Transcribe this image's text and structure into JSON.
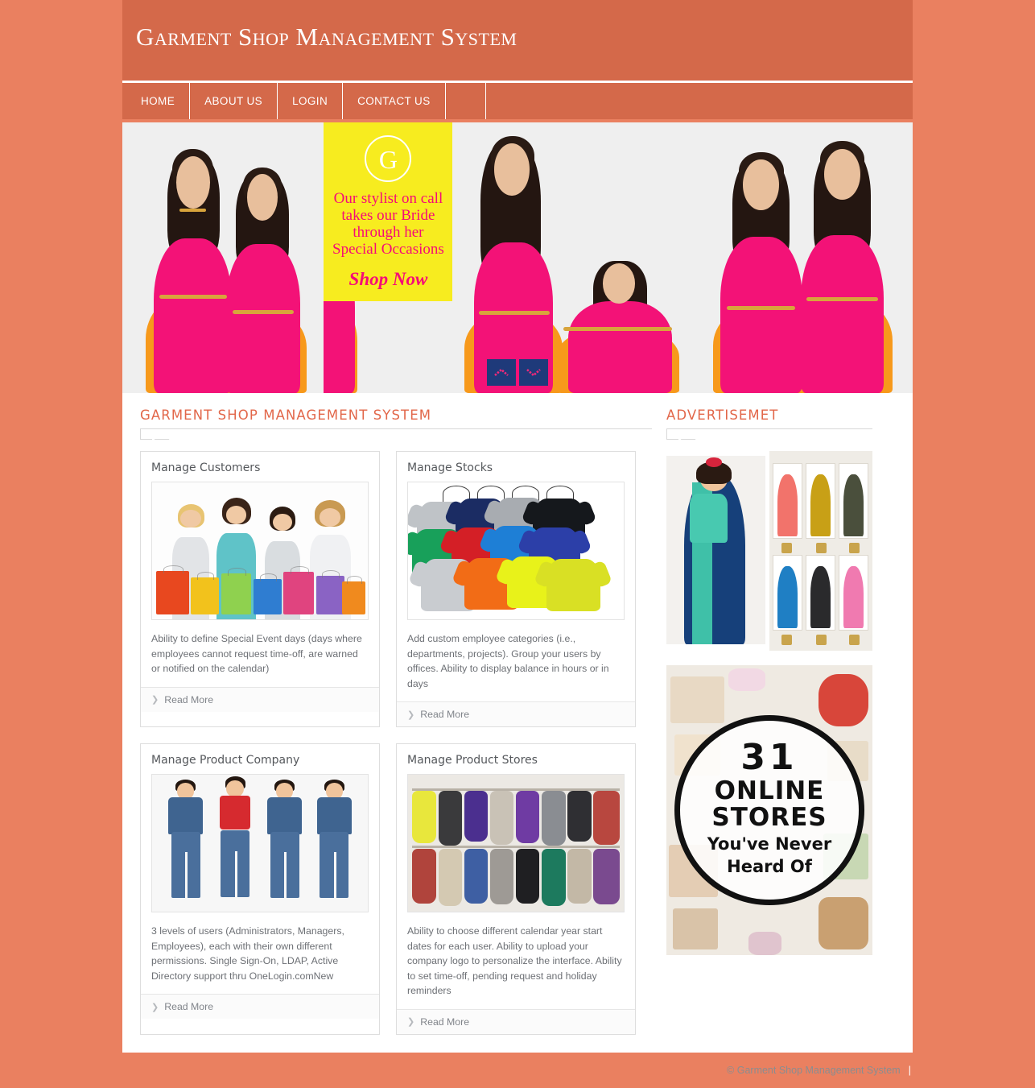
{
  "site": {
    "title": "Garment Shop Management System"
  },
  "nav": {
    "items": [
      {
        "label": "HOME"
      },
      {
        "label": "ABOUT US"
      },
      {
        "label": "LOGIN"
      },
      {
        "label": "CONTACT US"
      }
    ]
  },
  "banner": {
    "promo": {
      "logo_letter": "G",
      "line1": "Our  stylist on call",
      "line2": "takes our Bride",
      "line3": "through her",
      "line4": "Special Occasions",
      "cta": "Shop Now"
    },
    "controls": {
      "prev": "chevron-up-icon",
      "next": "chevron-down-icon"
    }
  },
  "main": {
    "section_heading": "GARMENT SHOP MANAGEMENT SYSTEM",
    "read_more_label": "Read More",
    "cards": [
      {
        "title": "Manage Customers",
        "text": "Ability to define Special Event days (days where employees cannot request time-off, are warned or notified on the calendar)",
        "image": "shopping-women-photo"
      },
      {
        "title": "Manage Stocks",
        "text": "Add custom employee categories (i.e., departments, projects). Group your users by offices. Ability to display balance in hours or in days",
        "image": "colored-tshirts-photo"
      },
      {
        "title": "Manage Product Company",
        "text": "3 levels of users (Administrators, Managers, Employees), each with their own different permissions. Single Sign-On, LDAP, Active Directory support thru OneLogin.comNew",
        "image": "kids-denim-photo"
      },
      {
        "title": "Manage Product Stores",
        "text": "Ability to choose different calendar year start dates for each user. Ability to upload your company logo to personalize the interface. Ability to set time-off, pending request and holiday reminders",
        "image": "clothing-racks-photo"
      }
    ]
  },
  "sidebar": {
    "heading": "ADVERTISEMET",
    "ads": [
      {
        "name": "saree-catalog-ad"
      },
      {
        "name": "online-stores-ad",
        "number": "31",
        "line1": "ONLINE",
        "line2": "STORES",
        "line3": "You've Never",
        "line4": "Heard Of"
      }
    ]
  },
  "footer": {
    "copyright": "© Garment Shop Management System",
    "separator": "|"
  },
  "colors": {
    "page_background": "#ea8060",
    "header": "#d4694a",
    "accent": "#e2674a",
    "promo_background": "#f7ec1f",
    "promo_text": "#f50b78",
    "slider_button": "#1e3a7a"
  }
}
